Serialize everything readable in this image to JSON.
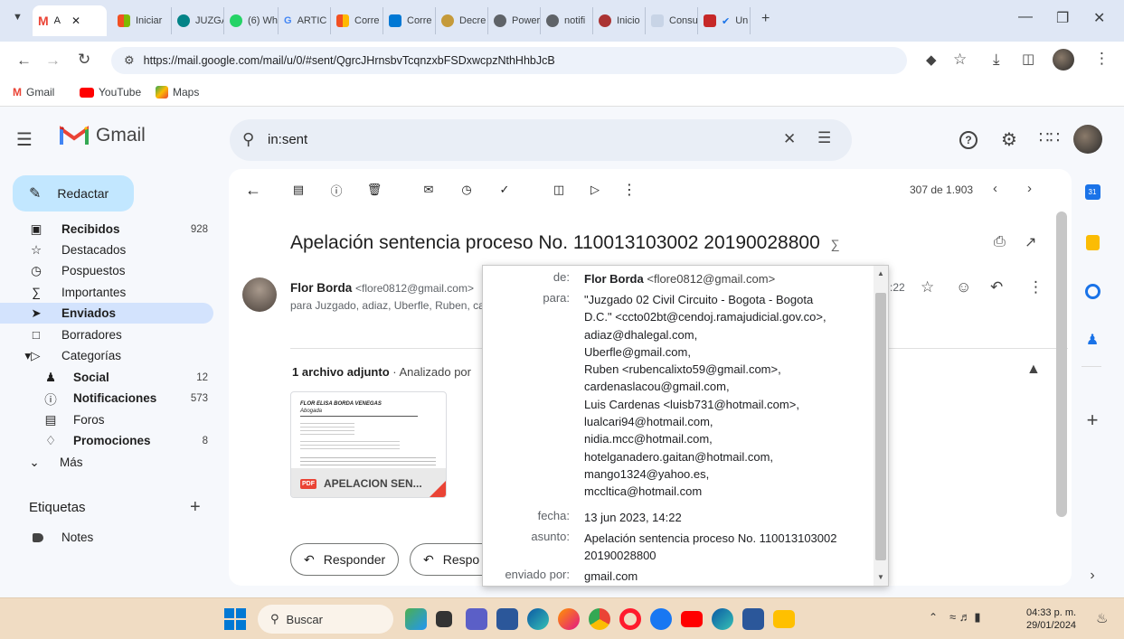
{
  "browser": {
    "tabs": [
      {
        "label": "A",
        "active": true
      },
      {
        "label": "Iniciar"
      },
      {
        "label": "JUZGA"
      },
      {
        "label": "(6) Wh"
      },
      {
        "label": "ARTIC"
      },
      {
        "label": "Corre"
      },
      {
        "label": "Corre"
      },
      {
        "label": "Decre"
      },
      {
        "label": "Power"
      },
      {
        "label": "notifi"
      },
      {
        "label": "Inicio"
      },
      {
        "label": "Consu"
      },
      {
        "label": "Un"
      }
    ],
    "new_tab": "+",
    "url": "https://mail.google.com/mail/u/0/#sent/QgrcJHrnsbvTcqnzxbFSDxwcpzNthHhbJcB",
    "bookmarks": [
      "Gmail",
      "YouTube",
      "Maps"
    ]
  },
  "gmail": {
    "logo_text": "Gmail",
    "search_value": "in:sent",
    "compose": "Redactar",
    "nav": [
      {
        "label": "Recibidos",
        "count": "928",
        "bold": true
      },
      {
        "label": "Destacados",
        "count": ""
      },
      {
        "label": "Pospuestos",
        "count": ""
      },
      {
        "label": "Importantes",
        "count": ""
      },
      {
        "label": "Enviados",
        "count": "",
        "bold": true,
        "active": true
      },
      {
        "label": "Borradores",
        "count": ""
      },
      {
        "label": "Categorías",
        "count": ""
      }
    ],
    "categories": [
      {
        "label": "Social",
        "count": "12",
        "bold": true
      },
      {
        "label": "Notificaciones",
        "count": "573",
        "bold": true
      },
      {
        "label": "Foros",
        "count": ""
      },
      {
        "label": "Promociones",
        "count": "8",
        "bold": true
      }
    ],
    "more": "Más",
    "labels_header": "Etiquetas",
    "labels": [
      "Notes"
    ]
  },
  "email": {
    "pagination": "307 de 1.903",
    "subject": "Apelación sentencia proceso No. 110013103002 20190028800",
    "sender_name": "Flor Borda",
    "sender_email": "<flore0812@gmail.com>",
    "recipients_summary": "para Juzgado, adiaz, Uberfle, Ruben, car",
    "time_partial": ":22",
    "attachments_header": "1 archivo adjunto",
    "attachments_scan": "· Analizado por",
    "attachment_name": "APELACION SEN...",
    "attachment_preview_title": "FLOR ELISA BORDA VENEGAS",
    "attachment_preview_sub": "Abogada",
    "reply": "Responder",
    "reply_all": "Respo"
  },
  "details": {
    "from_label": "de:",
    "from_name": "Flor Borda",
    "from_email": "<flore0812@gmail.com>",
    "to_label": "para:",
    "to_lines": [
      "\"Juzgado 02 Civil Circuito - Bogota - Bogota",
      "D.C.\" <ccto02bt@cendoj.ramajudicial.gov.co>,",
      "adiaz@dhalegal.com,",
      "Uberfle@gmail.com,",
      "Ruben <rubencalixto59@gmail.com>,",
      "cardenaslacou@gmail.com,",
      "Luis Cardenas <luisb731@hotmail.com>,",
      "lualcari94@hotmail.com,",
      "nidia.mcc@hotmail.com,",
      "hotelganadero.gaitan@hotmail.com,",
      "mango1324@yahoo.es,",
      "mccltica@hotmail.com"
    ],
    "date_label": "fecha:",
    "date_value": "13 jun 2023, 14:22",
    "subject_label": "asunto:",
    "subject_lines": [
      "Apelación sentencia proceso No. 110013103002",
      "20190028800"
    ],
    "sent_by_label": "enviado por:",
    "sent_by_value": "gmail.com"
  },
  "taskbar": {
    "search": "Buscar",
    "time": "04:33 p. m.",
    "date": "29/01/2024"
  }
}
